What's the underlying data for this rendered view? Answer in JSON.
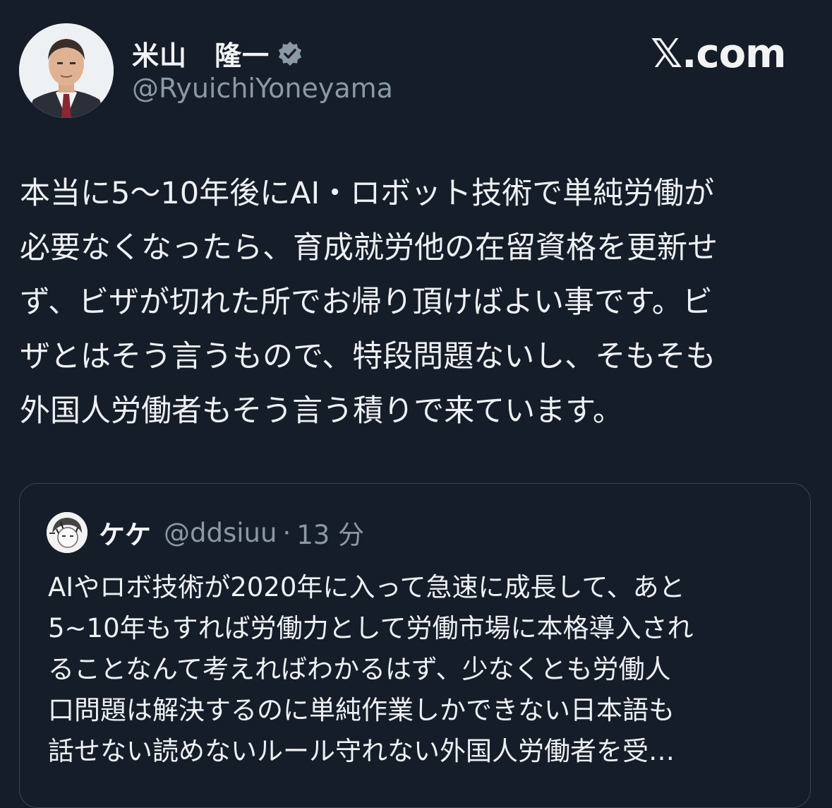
{
  "author": {
    "display_name": "米山　隆一",
    "handle": "@RyuichiYoneyama",
    "verified_icon": "verified-badge-icon"
  },
  "brand": {
    "label": "𝕏.com"
  },
  "tweet": {
    "text": "本当に5〜10年後にAI・ロボット技術で単純労働が\n必要なくなったら、育成就労他の在留資格を更新せ\nず、ビザが切れた所でお帰り頂けばよい事です。ビ\nザとはそう言うもので、特段問題ないし、そもそも\n外国人労働者もそう言う積りで来ています。"
  },
  "quoted": {
    "display_name": "ケケ",
    "handle": "@ddsiuu",
    "separator": "·",
    "time": "13 分",
    "text": "AIやロボ技術が2020年に入って急速に成長して、あと\n5~10年もすれば労働力として労働市場に本格導入され\nることなんて考えればわかるはず、少なくとも労働人\n口問題は解決するのに単純作業しかできない日本語も\n話せない読めないルール守れない外国人労働者を受…"
  },
  "colors": {
    "background": "#151d28",
    "text": "#eef1f3",
    "secondary": "#8b98a5",
    "border": "#3a434e"
  }
}
